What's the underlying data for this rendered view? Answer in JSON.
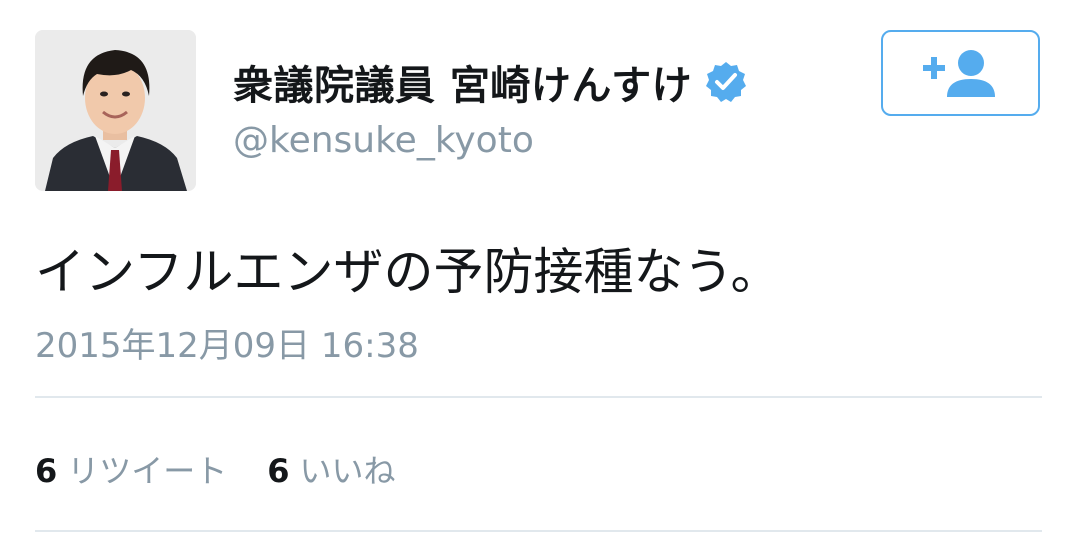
{
  "user": {
    "display_name": "衆議院議員 宮崎けんすけ",
    "handle": "@kensuke_kyoto",
    "verified": true,
    "avatar_icon": "profile-photo"
  },
  "follow_button": {
    "icon": "add-user-icon"
  },
  "tweet": {
    "text": "インフルエンザの予防接種なう。",
    "timestamp": "2015年12月09日 16:38"
  },
  "stats": {
    "retweet_count": "6",
    "retweet_label": "リツイート",
    "like_count": "6",
    "like_label": "いいね"
  },
  "colors": {
    "accent": "#55acee",
    "text_primary": "#14171a",
    "text_secondary": "#8899a6",
    "divider": "#e1e8ed"
  }
}
